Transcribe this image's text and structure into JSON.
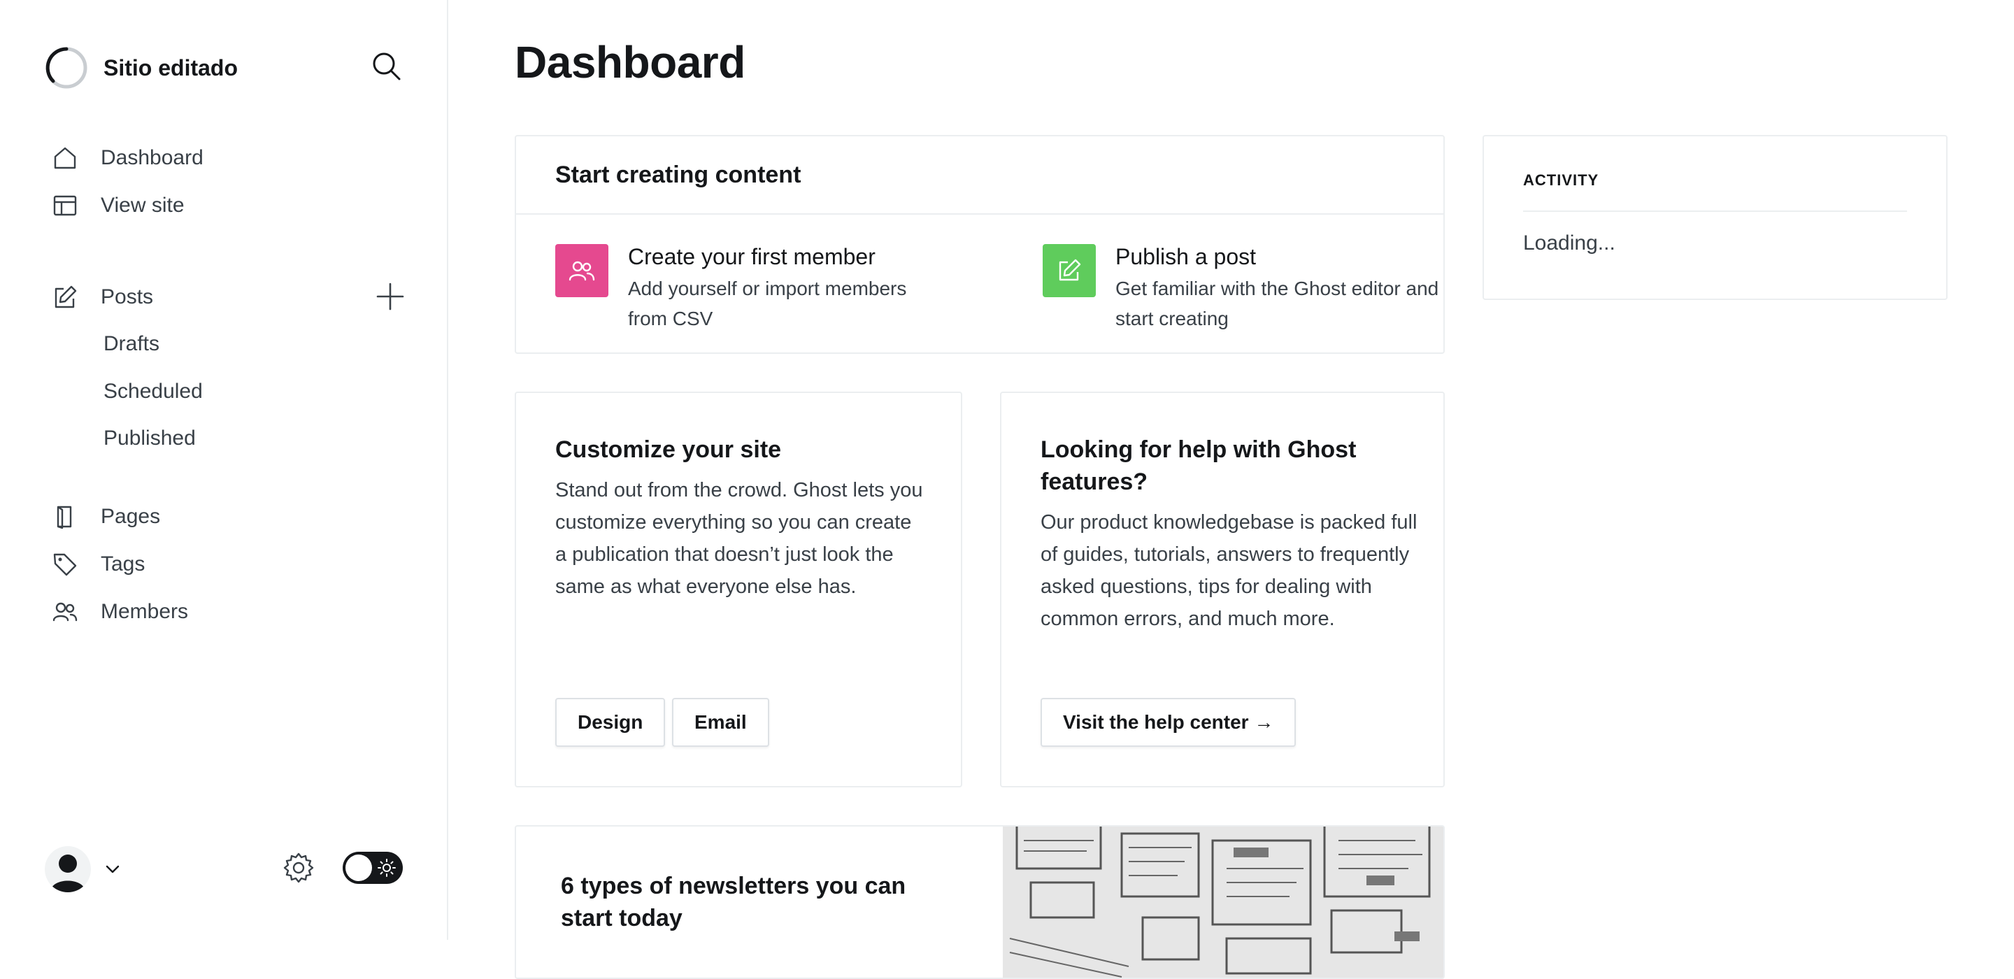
{
  "sidebar": {
    "site_name": "Sitio editado",
    "nav": {
      "dashboard": "Dashboard",
      "view_site": "View site",
      "posts": "Posts",
      "drafts": "Drafts",
      "scheduled": "Scheduled",
      "published": "Published",
      "pages": "Pages",
      "tags": "Tags",
      "members": "Members"
    },
    "icons": {
      "search": "search-icon",
      "add_post": "plus-icon",
      "settings": "gear-icon",
      "theme": "sun-icon",
      "account_menu": "chevron-down-icon"
    }
  },
  "main": {
    "title": "Dashboard",
    "start_card": {
      "title": "Start creating content",
      "member_action": {
        "title": "Create your first member",
        "description": "Add yourself or import members from CSV",
        "color": "#e5498f"
      },
      "post_action": {
        "title": "Publish a post",
        "description": "Get familiar with the Ghost editor and start creating",
        "color": "#5fcc5c"
      }
    },
    "activity": {
      "label": "ACTIVITY",
      "status": "Loading..."
    },
    "customize_card": {
      "title": "Customize your site",
      "body": "Stand out from the crowd. Ghost lets you customize everything so you can create a publication that doesn’t just look the same as what everyone else has.",
      "design_button": "Design",
      "email_button": "Email"
    },
    "help_card": {
      "title": "Looking for help with Ghost features?",
      "body": "Our product knowledgebase is packed full of guides, tutorials, answers to frequently asked questions, tips for dealing with common errors, and much more.",
      "button": "Visit the help center →"
    },
    "newsletter_card": {
      "title": "6 types of newsletters you can start today"
    }
  }
}
